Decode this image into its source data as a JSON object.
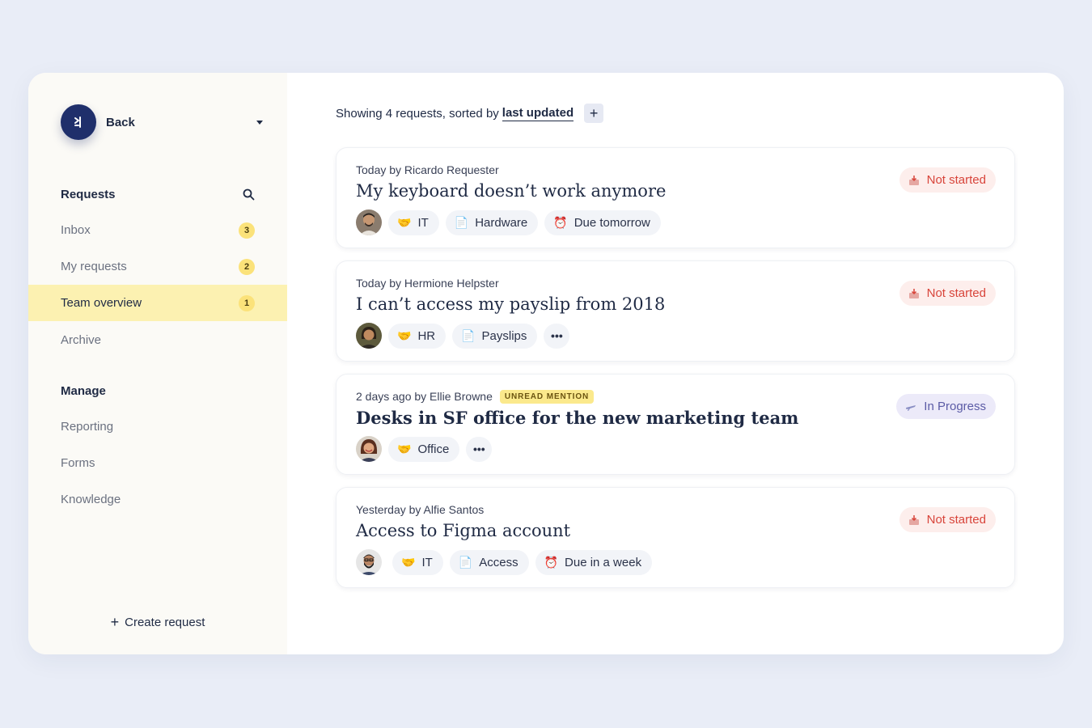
{
  "sidebar": {
    "workspace_label": "Back",
    "requests_heading": "Requests",
    "manage_heading": "Manage",
    "requests_items": [
      {
        "label": "Inbox",
        "count": "3"
      },
      {
        "label": "My requests",
        "count": "2"
      },
      {
        "label": "Team overview",
        "count": "1"
      },
      {
        "label": "Archive",
        "count": ""
      }
    ],
    "manage_items": [
      {
        "label": "Reporting"
      },
      {
        "label": "Forms"
      },
      {
        "label": "Knowledge"
      }
    ],
    "create_label": "Create request",
    "create_plus": "+"
  },
  "main": {
    "summary_prefix": "Showing 4 requests, sorted by",
    "summary_sort": "last updated",
    "add_glyph": "+",
    "requests": [
      {
        "meta": "Today by Ricardo Requester",
        "title": "My keyboard doesn’t work anymore",
        "tags": [
          {
            "icon": "handshake-icon",
            "glyph": "🤝",
            "label": "IT"
          },
          {
            "icon": "document-icon",
            "glyph": "📄",
            "label": "Hardware"
          },
          {
            "icon": "alarm-clock-icon",
            "glyph": "⏰",
            "label": "Due tomorrow"
          }
        ],
        "status": "Not started"
      },
      {
        "meta": "Today by Hermione Helpster",
        "title": "I can’t access my payslip from 2018",
        "tags": [
          {
            "icon": "handshake-icon",
            "glyph": "🤝",
            "label": "HR"
          },
          {
            "icon": "document-icon",
            "glyph": "📄",
            "label": "Payslips"
          }
        ],
        "more": "•••",
        "status": "Not started"
      },
      {
        "meta": "2 days ago by Ellie Browne",
        "mention": "UNREAD MENTION",
        "title": "Desks in SF office for the new marketing team",
        "tags": [
          {
            "icon": "handshake-icon",
            "glyph": "🤝",
            "label": "Office"
          }
        ],
        "more": "•••",
        "status": "In Progress"
      },
      {
        "meta": "Yesterday by Alfie Santos",
        "title": "Access to Figma account",
        "tags": [
          {
            "icon": "handshake-icon",
            "glyph": "🤝",
            "label": "IT"
          },
          {
            "icon": "document-icon",
            "glyph": "📄",
            "label": "Access"
          },
          {
            "icon": "alarm-clock-icon",
            "glyph": "⏰",
            "label": "Due in a week"
          }
        ],
        "status": "Not started"
      }
    ]
  },
  "colors": {
    "page_bg": "#e9edf7",
    "brand": "#1f2f6b",
    "active_nav_bg": "#fcf1b1",
    "badge": "#fbe27a",
    "not_started": "#d8443a",
    "in_progress": "#5b5ba6"
  }
}
